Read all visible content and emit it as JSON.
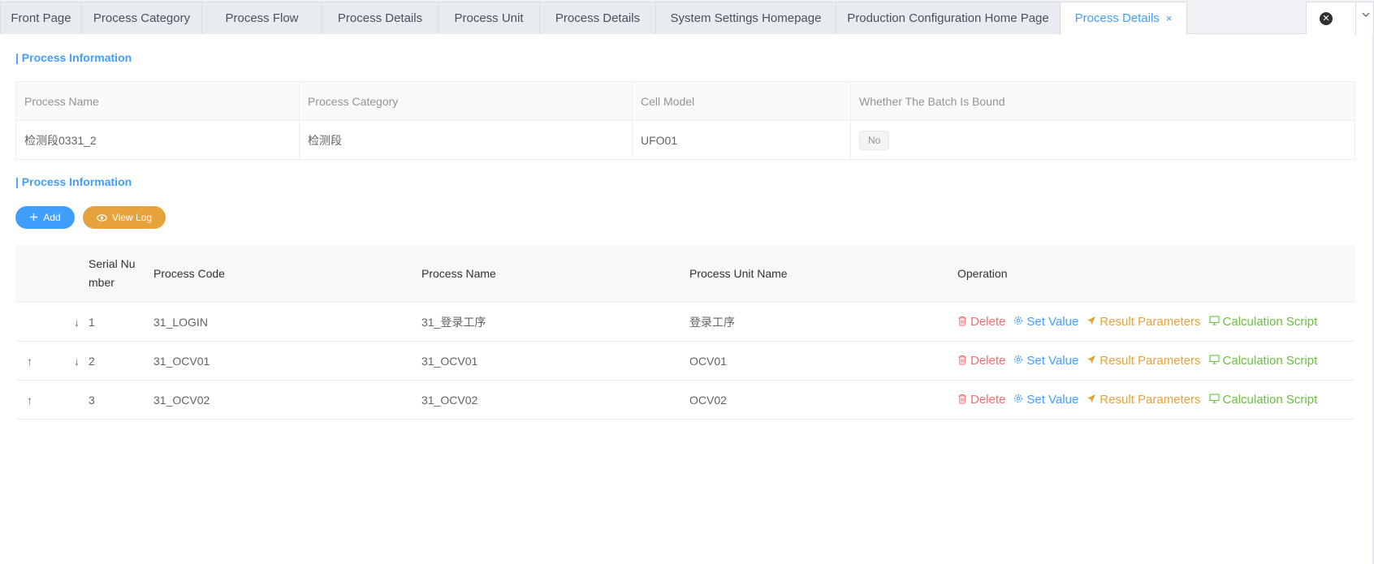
{
  "tabs": [
    {
      "label": "Front Page",
      "active": false
    },
    {
      "label": "Process Category",
      "active": false
    },
    {
      "label": "Process Flow",
      "active": false
    },
    {
      "label": "Process Details",
      "active": false
    },
    {
      "label": "Process Unit",
      "active": false
    },
    {
      "label": "Process Details",
      "active": false
    },
    {
      "label": "System Settings Homepage",
      "active": false
    },
    {
      "label": "Production Configuration Home Page",
      "active": false
    },
    {
      "label": "Process Details",
      "active": true
    }
  ],
  "tab_close_glyph": "×",
  "section1": {
    "title": "| Process Information"
  },
  "info": {
    "headers": [
      "Process Name",
      "Process Category",
      "Cell Model",
      "Whether The Batch Is Bound"
    ],
    "values": [
      "检测段0331_2",
      "检测段",
      "UFO01",
      "No"
    ]
  },
  "section2": {
    "title": "| Process Information"
  },
  "buttons": {
    "add": "Add",
    "view_log": "View Log"
  },
  "grid": {
    "headers": {
      "serial": "Serial Number",
      "code": "Process Code",
      "name": "Process Name",
      "unit": "Process Unit Name",
      "operation": "Operation"
    },
    "rows": [
      {
        "up": "",
        "down": "↓",
        "serial": "1",
        "code": "31_LOGIN",
        "name": "31_登录工序",
        "unit": "登录工序"
      },
      {
        "up": "↑",
        "down": "↓",
        "serial": "2",
        "code": "31_OCV01",
        "name": "31_OCV01",
        "unit": "OCV01"
      },
      {
        "up": "↑",
        "down": "",
        "serial": "3",
        "code": "31_OCV02",
        "name": "31_OCV02",
        "unit": "OCV02"
      }
    ],
    "ops": {
      "delete": "Delete",
      "set_value": "Set Value",
      "result_params": "Result Parameters",
      "calc_script": "Calculation Script"
    }
  },
  "colors": {
    "primary": "#409eff",
    "danger": "#f56c6c",
    "warning": "#e6a23c",
    "success": "#67c23a"
  }
}
